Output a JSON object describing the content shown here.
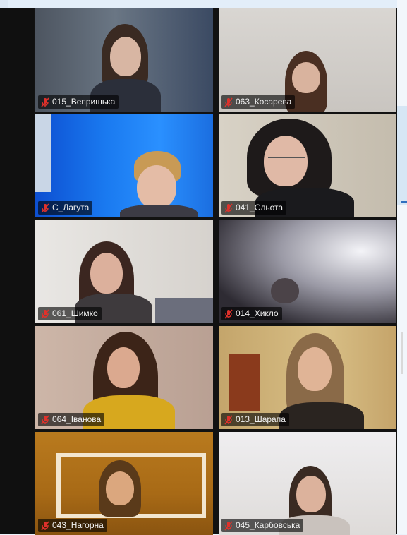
{
  "participants": [
    {
      "name": "015_Вепришька",
      "mic": "muted-mic-icon"
    },
    {
      "name": "063_Косарева",
      "mic": "muted-mic-icon"
    },
    {
      "name": "С_Лагута",
      "mic": "muted-mic-icon"
    },
    {
      "name": "041_Сльота",
      "mic": "muted-mic-icon"
    },
    {
      "name": "061_Шимко",
      "mic": "muted-mic-icon"
    },
    {
      "name": "014_Хикло",
      "mic": "muted-mic-icon"
    },
    {
      "name": "064_Іванова",
      "mic": "muted-mic-icon"
    },
    {
      "name": "013_Шарапа",
      "mic": "muted-mic-icon"
    },
    {
      "name": "043_Нагорна",
      "mic": "muted-mic-icon"
    },
    {
      "name": "045_Карбовська",
      "mic": "muted-mic-icon"
    }
  ],
  "colors": {
    "muted_mic": "#e0312b",
    "tile_border": "#121212"
  }
}
